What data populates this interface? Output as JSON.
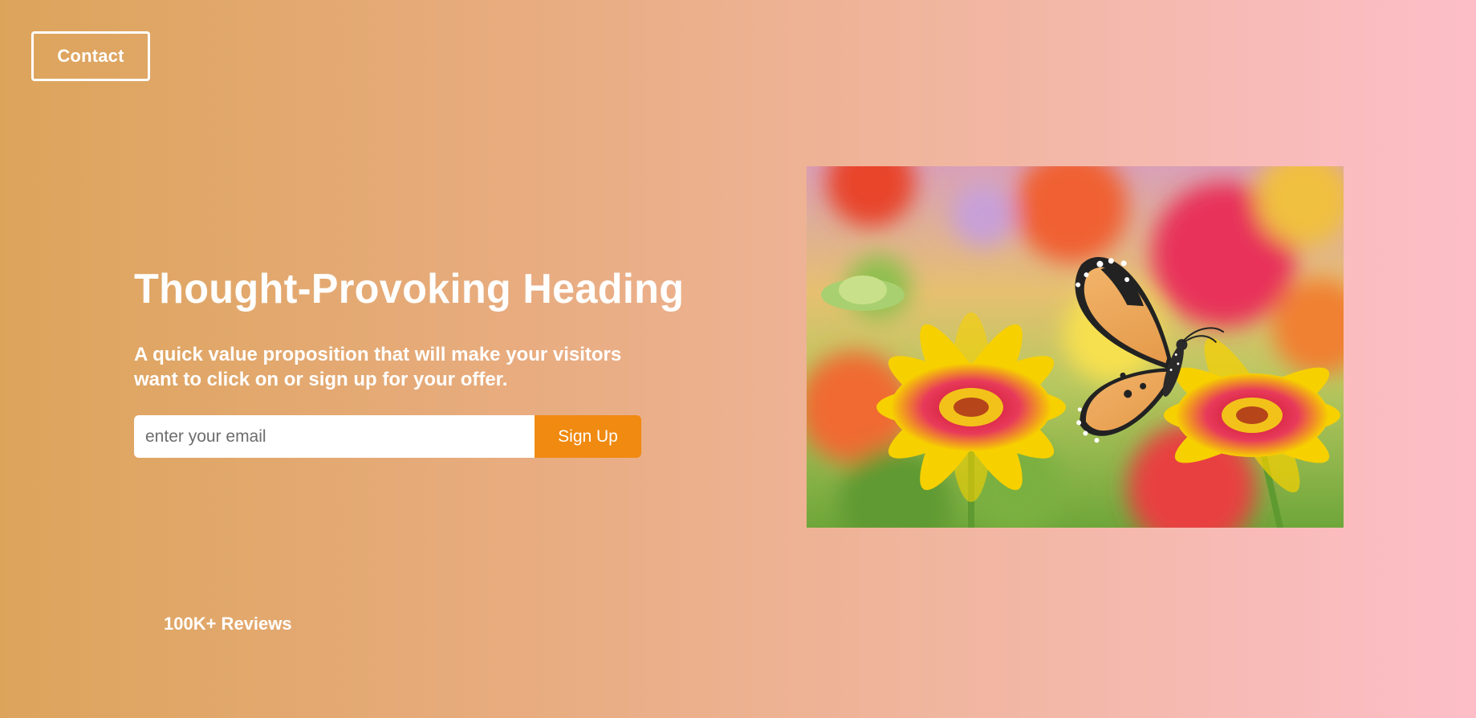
{
  "header": {
    "contact_label": "Contact"
  },
  "hero": {
    "heading": "Thought-Provoking Heading",
    "subheading": "A quick value proposition that will make your visitors want to click on or sign up for your offer.",
    "email": {
      "value": "",
      "placeholder": "enter your email"
    },
    "signup_label": "Sign Up",
    "image_alt": "butterfly-on-flowers"
  },
  "footer": {
    "reviews_text": "100K+ Reviews"
  },
  "colors": {
    "gradient_start": "#dca45b",
    "gradient_end": "#fdbec8",
    "accent": "#f08a10",
    "text": "#ffffff"
  }
}
